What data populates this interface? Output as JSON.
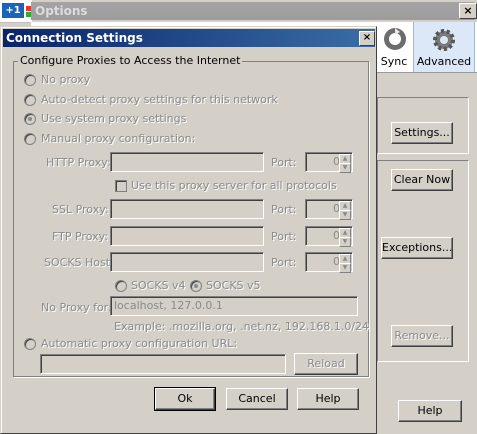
{
  "taskbar": {
    "badge": "+1"
  },
  "options_window": {
    "title": "Options",
    "close_glyph": "×",
    "toolbar": {
      "sync": "Sync",
      "advanced": "Advanced"
    },
    "buttons": {
      "settings": "Settings...",
      "clear_now": "Clear Now",
      "exceptions": "Exceptions...",
      "remove": "Remove...",
      "help": "Help"
    }
  },
  "dialog": {
    "title": "Connection Settings",
    "close_glyph": "×",
    "group_label": "Configure Proxies to Access the Internet",
    "radios": {
      "no_proxy": "No proxy",
      "auto_detect": "Auto-detect proxy settings for this network",
      "system": "Use system proxy settings",
      "manual": "Manual proxy configuration:",
      "auto_url": "Automatic proxy configuration URL:"
    },
    "labels": {
      "http": "HTTP Proxy:",
      "ssl": "SSL Proxy:",
      "ftp": "FTP Proxy:",
      "socks": "SOCKS Host:",
      "port": "Port:",
      "no_proxy_for": "No Proxy for:"
    },
    "ports": {
      "http": "0",
      "ssl": "0",
      "ftp": "0",
      "socks": "0"
    },
    "use_same_proxy": "Use this proxy server for all protocols",
    "socks_v4": "SOCKS v4",
    "socks_v5": "SOCKS v5",
    "no_proxy_value": "localhost, 127.0.0.1",
    "example": "Example: .mozilla.org, .net.nz, 192.168.1.0/24",
    "auto_url_value": "",
    "reload": "Reload",
    "ok": "Ok",
    "cancel": "Cancel",
    "help": "Help"
  }
}
